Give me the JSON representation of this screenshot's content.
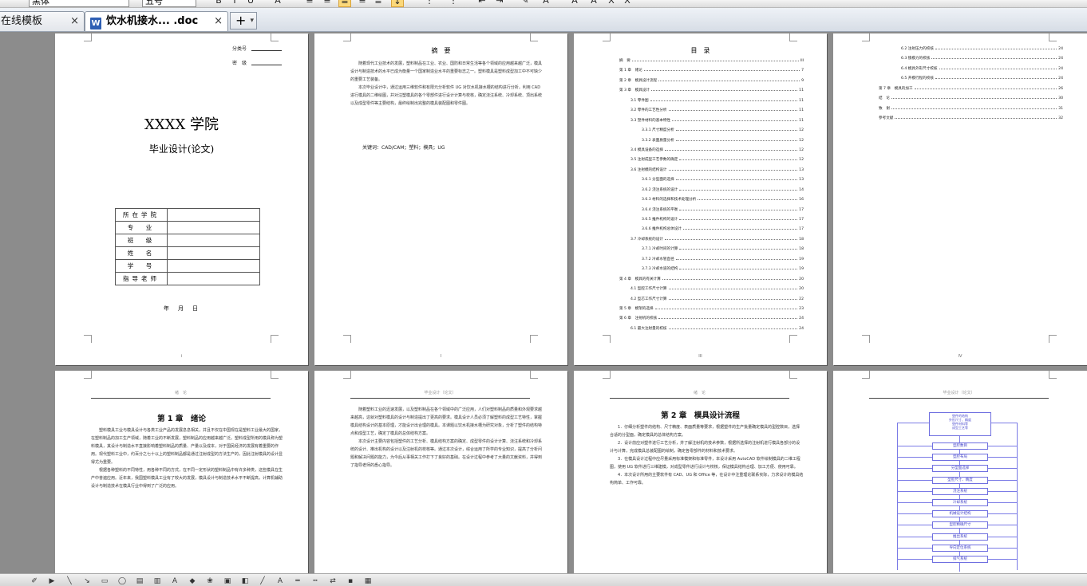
{
  "toolbar": {
    "font_name": "黑体",
    "font_size": "五号",
    "buttons": [
      {
        "name": "bold-button",
        "glyph": "B"
      },
      {
        "name": "italic-button",
        "glyph": "I"
      },
      {
        "name": "underline-button",
        "glyph": "U"
      },
      {
        "name": "font-color-button",
        "glyph": "A"
      },
      {
        "name": "align-left-button",
        "glyph": "≡"
      },
      {
        "name": "align-center-button",
        "glyph": "≡"
      },
      {
        "name": "align-justify-button",
        "glyph": "≡"
      },
      {
        "name": "align-right-button",
        "glyph": "≡"
      },
      {
        "name": "distribute-button",
        "glyph": "≣"
      },
      {
        "name": "line-spacing-button",
        "glyph": "↕"
      },
      {
        "name": "numbering-button",
        "glyph": "⋮"
      },
      {
        "name": "bullets-button",
        "glyph": "⋮"
      },
      {
        "name": "decrease-indent-button",
        "glyph": "⇤"
      },
      {
        "name": "increase-indent-button",
        "glyph": "⇥"
      },
      {
        "name": "highlight-button",
        "glyph": "✎"
      },
      {
        "name": "font-color2-button",
        "glyph": "A"
      },
      {
        "name": "grow-font-button",
        "glyph": "A"
      },
      {
        "name": "shrink-font-button",
        "glyph": "A"
      },
      {
        "name": "superscript-button",
        "glyph": "X"
      },
      {
        "name": "subscript-button",
        "glyph": "X"
      }
    ]
  },
  "tabs": [
    {
      "label": "在线模板",
      "close": "×",
      "active": false
    },
    {
      "label": "饮水机接水... .doc",
      "close": "×",
      "active": true
    }
  ],
  "new_tab": {
    "label": "+",
    "dropdown": "▾"
  },
  "pages": {
    "cover": {
      "field1_label": "分类号",
      "field2_label": "密　级",
      "school": "XXXX 学院",
      "subtitle": "毕业设计(论文)",
      "table_rows": [
        "所在学院",
        "专　业",
        "班　级",
        "姓　名",
        "学　号",
        "指导老师"
      ],
      "date": "年　月　日",
      "page_number": "i"
    },
    "abstract": {
      "title": "摘　要",
      "p1": "随着现代工业技术的发展，塑料制品在工业、农业、国防和日常生活等各个领域的应用越来越广泛，模具设计与制造技术的水平已成为衡量一个国家制造业水平的重要标志之一。塑料模具是塑料成型加工中不可缺少的重要工艺装备。",
      "p2": "本次毕业设计中，通过运用三维软件和有限元分析软件 UG 对饮水机接水槽的结构进行分析，利用 CAD 进行模具的二维绘图，并对注塑模具的各个零部件进行设计计算与校核，确定浇注系统、冷却系统、顶出系统以及成型零件等主要结构，最终绘制出完整的模具装配图和零件图。",
      "keywords": "关键词：CAD/CAM；塑料；模具；UG",
      "page_number": "I"
    },
    "toc": {
      "title": "目　录",
      "entries": [
        {
          "label": "摘　要",
          "page": "III",
          "indent": 0
        },
        {
          "label": "第 1 章　绪论",
          "page": "7",
          "indent": 0
        },
        {
          "label": "第 2 章　模具设计流程",
          "page": "9",
          "indent": 0
        },
        {
          "label": "第 3 章　模具设计",
          "page": "11",
          "indent": 0
        },
        {
          "label": "3.1 零件图",
          "page": "11",
          "indent": 1
        },
        {
          "label": "3.2 零件的工艺性分析",
          "page": "11",
          "indent": 1
        },
        {
          "label": "3.3 塑件材料的基本特性",
          "page": "11",
          "indent": 1
        },
        {
          "label": "3.3.1 尺寸精度分析",
          "page": "12",
          "indent": 2
        },
        {
          "label": "3.3.2 表面质量分析",
          "page": "12",
          "indent": 2
        },
        {
          "label": "3.4 模具设备的选择",
          "page": "12",
          "indent": 1
        },
        {
          "label": "3.5 注射成型工艺参数的确定",
          "page": "12",
          "indent": 1
        },
        {
          "label": "3.6 注射模的结构设计",
          "page": "13",
          "indent": 1
        },
        {
          "label": "3.6.1 分型面的选择",
          "page": "13",
          "indent": 2
        },
        {
          "label": "3.6.2 浇注系统的设计",
          "page": "14",
          "indent": 2
        },
        {
          "label": "3.6.3 材料的选择和技术处理分析",
          "page": "16",
          "indent": 2
        },
        {
          "label": "3.6.4 浇注系统的平衡",
          "page": "17",
          "indent": 2
        },
        {
          "label": "3.6.5 推件机构的设计",
          "page": "17",
          "indent": 2
        },
        {
          "label": "3.6.6 推件机构总体设计",
          "page": "17",
          "indent": 2
        },
        {
          "label": "3.7 冷却系统的设计",
          "page": "18",
          "indent": 1
        },
        {
          "label": "3.7.1 冷却时间的计算",
          "page": "18",
          "indent": 2
        },
        {
          "label": "3.7.2 冷却水管直径",
          "page": "19",
          "indent": 2
        },
        {
          "label": "3.7.3 冷却水道的结构",
          "page": "19",
          "indent": 2
        },
        {
          "label": "第 4 章　模具的有关计算",
          "page": "20",
          "indent": 0
        },
        {
          "label": "4.1 型腔工作尺寸计算",
          "page": "20",
          "indent": 1
        },
        {
          "label": "4.2 型芯工作尺寸计算",
          "page": "22",
          "indent": 1
        },
        {
          "label": "第 5 章　模架的选择",
          "page": "23",
          "indent": 0
        },
        {
          "label": "第 6 章　注射机的校核",
          "page": "24",
          "indent": 0
        },
        {
          "label": "6.1 最大注射量的校核",
          "page": "24",
          "indent": 1
        }
      ],
      "page_number": "III"
    },
    "toc2": {
      "entries": [
        {
          "label": "6.2 注射压力的校核",
          "page": "24",
          "indent": 2
        },
        {
          "label": "6.3 锁模力的校核",
          "page": "24",
          "indent": 2
        },
        {
          "label": "6.4 模具外形尺寸校核",
          "page": "24",
          "indent": 2
        },
        {
          "label": "6.5 开模行程的校核",
          "page": "24",
          "indent": 2
        },
        {
          "label": "第 7 章　模具的加工",
          "page": "26",
          "indent": 0
        },
        {
          "label": "结　论",
          "page": "30",
          "indent": 0
        },
        {
          "label": "致　谢",
          "page": "31",
          "indent": 0
        },
        {
          "label": "参考文献",
          "page": "32",
          "indent": 0
        }
      ],
      "page_number": "IV"
    },
    "chapter1": {
      "header": "绪　论",
      "heading": "第 1 章　绪论",
      "p1": "塑料模具工业与模具设计与各类工业产品的发展息息相关，并且不仅在中国现在是塑料工业最大的国家，在塑料制品的加工生产领域，随着工业的不断发展，塑料制品的应用越来越广泛。塑料成型所用的模具称为塑料模具，其设计与制造水平直接影响着塑料制品的质量、产量以及成本，对于国民经济的发展有着重要的作用。现代塑料工业中，约百分之七十以上的塑料制品都是通过注射成型的方法生产的，因此注射模具的设计显得尤为重要。",
      "p2": "根据各种塑料的不同特性，用各种不同的方式，在不同一定形状的塑料制品中有许多种类，这些模具在生产中普遍应用。近年来，我国塑料模具工业有了较大的发展，模具设计与制造技术水平不断提高，计算机辅助设计与制造技术在模具行业中得到了广泛的应用。"
    },
    "chapter1b": {
      "header": "毕业设计（论文）",
      "p1": "随着塑料工业的迅速发展，以及塑料制品在各个领域中的广泛应用，人们对塑料制品的质量和外观要求越来越高，这就对塑料模具的设计与制造提出了更高的要求。模具设计人员必须了解塑料的成型工艺特性，掌握模具结构设计的基本原理，才能设计出合理的模具。本课题以饮水机接水槽为研究对象，分析了塑件的结构特点和成型工艺，确定了模具的总体结构方案。",
      "p2": "本次设计主要内容包括塑件的工艺分析、模具结构方案的确定、成型零件的设计计算、浇注系统和冷却系统的设计、推出机构的设计以及注射机的校核等。通过本次设计，综合运用了所学的专业知识，提高了分析问题和解决问题的能力，为今后从事相关工作打下了良好的基础。在设计过程中参考了大量的文献资料，并得到了指导老师的悉心指导。"
    },
    "chapter2": {
      "header": "绪　论",
      "heading": "第 2 章　模具设计流程",
      "p1": "1．仔细分析塑件的结构、尺寸精度、表面质量等要求，根据塑件的生产批量确定模具的型腔数目，选择合适的分型面，确定模具的总体结构方案。",
      "p2": "2．设计前应对塑件进行工艺分析，并了解注射机的技术参数，根据所选择的注射机进行模具各部分的设计与计算，完成模具总装配图的绘制，确定各零部件的材料和技术要求。",
      "p3": "3．在模具设计过程中应尽量采用标准模架和标准零件，本设计采用 AutoCAD 软件绘制模具的二维工程图，使用 UG 软件进行三维建模，对成型零件进行设计与校核，保证模具结构合理、加工方便、使用可靠。",
      "p4": "4．本次设计所用的主要软件有 CAD、UG 和 Office 等，在设计中注重理论联系实际，力求设计的模具结构简单、工作可靠。"
    },
    "flowchart": {
      "header": "毕业设计（论文）",
      "top_box": "塑件的结构\n外形尺寸、精度\n塑件材料等\n成型工艺等",
      "steps": [
        "型腔数目",
        "型腔布局",
        "分型面选择",
        "型腔尺寸、精度",
        "浇注系统",
        "冷却系统",
        "机械设计结构",
        "型腔精确尺寸",
        "推出系统",
        "导向定位系统",
        "排气系统"
      ]
    }
  },
  "bottom_icons": [
    "draw-menu-icon",
    "select-arrow-icon",
    "line-icon",
    "arrow-icon",
    "rectangle-icon",
    "ellipse-icon",
    "textbox-icon",
    "vertical-textbox-icon",
    "wordart-icon",
    "diagram-icon",
    "clipart-icon",
    "picture-icon",
    "fill-color-icon",
    "line-color-icon",
    "font-color-icon",
    "line-style-icon",
    "dash-style-icon",
    "arrow-style-icon",
    "shadow-icon",
    "3d-icon"
  ]
}
